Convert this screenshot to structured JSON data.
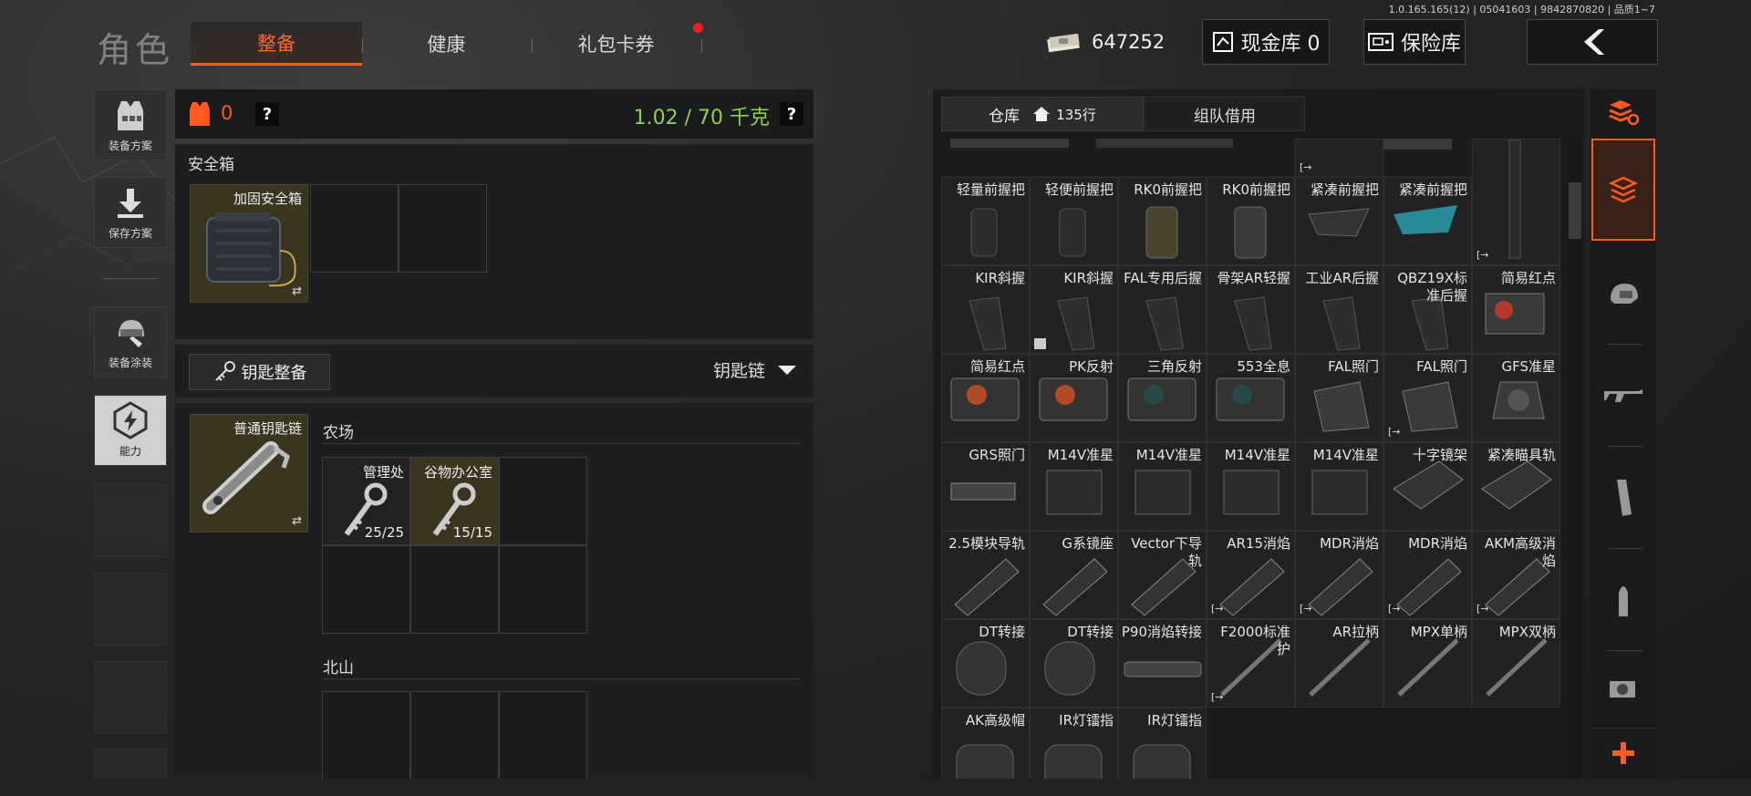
{
  "version": "1.0.165.165(12) | 05041603 | 9842870820 | 品质1~7",
  "header": {
    "title": "角色",
    "tabs": [
      {
        "label": "整备",
        "active": true
      },
      {
        "label": "健康",
        "active": false
      },
      {
        "label": "礼包卡券",
        "active": false
      }
    ],
    "money": "647252",
    "cash_vault": "现金库 0",
    "safe_vault": "保险库"
  },
  "sidebar": {
    "items": [
      {
        "label": "装备方案",
        "icon": "vest-icon"
      },
      {
        "label": "保存方案",
        "icon": "download-icon"
      },
      {
        "label": "装备涂装",
        "icon": "helmet-paint-icon"
      },
      {
        "label": "能力",
        "icon": "ability-icon"
      }
    ]
  },
  "loadout": {
    "armor_count": "0",
    "weight": "1.02 / 70 千克",
    "safe_box_title": "安全箱",
    "safe_box_item": "加固安全箱",
    "key_section_button": "钥匙整备",
    "key_dropdown": "钥匙链",
    "keychain_item": "普通钥匙链",
    "farm_label": "农场",
    "farm_keys": [
      {
        "name": "管理处",
        "uses": "25/25"
      },
      {
        "name": "谷物办公室",
        "uses": "15/15"
      }
    ],
    "north_label": "北山"
  },
  "warehouse": {
    "tab_warehouse": "仓库",
    "rows": "135行",
    "tab_team": "组队借用",
    "grid": [
      [
        "轻量前握把",
        "轻便前握把",
        "RK0前握把",
        "RK0前握把",
        "紧凑前握把",
        "紧凑前握把"
      ],
      [
        "KIR斜握",
        "KIR斜握",
        "FAL专用后握",
        "骨架AR轻握",
        "工业AR后握",
        "QBZ19X标准后握",
        "简易红点"
      ],
      [
        "简易红点",
        "PK反射",
        "三角反射",
        "553全息",
        "FAL照门",
        "FAL照门",
        "GFS准星"
      ],
      [
        "GRS照门",
        "M14V准星",
        "M14V准星",
        "M14V准星",
        "M14V准星",
        "十字镜架",
        "紧凑瞄具轨"
      ],
      [
        "2.5模块导轨",
        "G系镜座",
        "Vector下导轨",
        "AR15消焰",
        "MDR消焰",
        "MDR消焰",
        "AKM高级消焰"
      ],
      [
        "DT转接",
        "DT转接",
        "P90消焰转接",
        "F2000标准护",
        "AR拉柄",
        "MPX单柄",
        "MPX双柄"
      ],
      [
        "AK高级帽",
        "IR灯镭指",
        "IR灯镭指"
      ]
    ]
  },
  "colors": {
    "accent": "#ff5a1f",
    "weight_green": "#8fd14f",
    "item_yellow": "#3b351f"
  }
}
